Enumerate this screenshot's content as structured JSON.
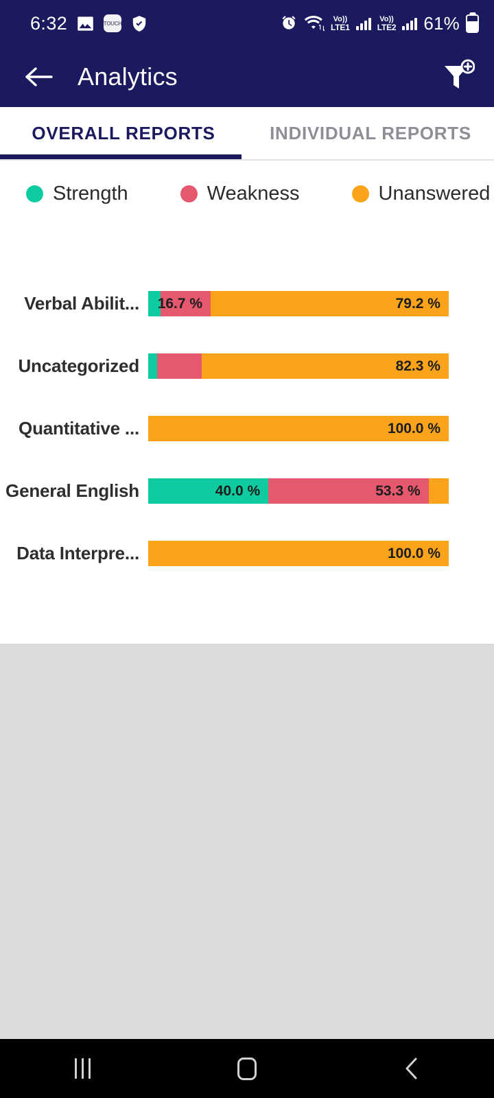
{
  "status_bar": {
    "time": "6:32",
    "left_icons": [
      "photo-icon",
      "touch-app-icon",
      "shield-check-icon"
    ],
    "app_badge_text": "TOUCH",
    "right_icons": [
      "alarm-icon",
      "wifi-icon"
    ],
    "sim1_label_top": "Vo))",
    "sim1_label_bottom": "LTE1",
    "sim2_label_top": "Vo))",
    "sim2_label_bottom": "LTE2",
    "battery_percent": "61%"
  },
  "app_bar": {
    "back_icon": "arrow-left-icon",
    "title": "Analytics",
    "filter_icon": "filter-add-icon"
  },
  "tabs": [
    {
      "label": "OVERALL REPORTS",
      "active": true
    },
    {
      "label": "INDIVIDUAL REPORTS",
      "active": false
    }
  ],
  "colors": {
    "strength": "#0FCCA0",
    "weakness": "#E5586D",
    "unanswered": "#FBA41B",
    "app_bar": "#1b1a5e",
    "gray_area": "#dcdcdc",
    "tab_active": "#1b1a5e",
    "tab_inactive": "#8e8e96"
  },
  "chart_data": {
    "type": "bar",
    "orientation": "horizontal",
    "stacked": true,
    "normalized_percent": true,
    "title": "",
    "xlabel": "",
    "ylabel": "",
    "xlim": [
      0,
      100
    ],
    "grid": false,
    "legend_position": "top-left",
    "legend": [
      {
        "name": "Strength",
        "color": "#0FCCA0"
      },
      {
        "name": "Weakness",
        "color": "#E5586D"
      },
      {
        "name": "Unanswered",
        "color": "#FBA41B"
      }
    ],
    "categories": [
      "Verbal Abilit...",
      "Uncategorized",
      "Quantitative ...",
      "General English",
      "Data Interpre..."
    ],
    "series": [
      {
        "name": "Strength",
        "values": [
          4.1,
          3.0,
          0.0,
          40.0,
          0.0
        ]
      },
      {
        "name": "Weakness",
        "values": [
          16.7,
          14.7,
          0.0,
          53.3,
          0.0
        ]
      },
      {
        "name": "Unanswered",
        "values": [
          79.2,
          82.3,
          100.0,
          6.7,
          100.0
        ]
      }
    ],
    "rows": [
      {
        "label": "Verbal Abilit...",
        "segments": [
          {
            "series": "Strength",
            "value": 4.1,
            "label": ""
          },
          {
            "series": "Weakness",
            "value": 16.7,
            "label": "16.7 %"
          },
          {
            "series": "Unanswered",
            "value": 79.2,
            "label": "79.2 %"
          }
        ]
      },
      {
        "label": "Uncategorized",
        "segments": [
          {
            "series": "Strength",
            "value": 3.0,
            "label": ""
          },
          {
            "series": "Weakness",
            "value": 14.7,
            "label": ""
          },
          {
            "series": "Unanswered",
            "value": 82.3,
            "label": "82.3 %"
          }
        ]
      },
      {
        "label": "Quantitative ...",
        "segments": [
          {
            "series": "Unanswered",
            "value": 100.0,
            "label": "100.0 %"
          }
        ]
      },
      {
        "label": "General English",
        "segments": [
          {
            "series": "Strength",
            "value": 40.0,
            "label": "40.0 %"
          },
          {
            "series": "Weakness",
            "value": 53.3,
            "label": "53.3 %"
          },
          {
            "series": "Unanswered",
            "value": 6.7,
            "label": ""
          }
        ]
      },
      {
        "label": "Data Interpre...",
        "segments": [
          {
            "series": "Unanswered",
            "value": 100.0,
            "label": "100.0 %"
          }
        ]
      }
    ]
  },
  "nav_bar": {
    "recents_icon": "recents-icon",
    "home_icon": "home-icon",
    "back_icon": "nav-back-icon"
  }
}
